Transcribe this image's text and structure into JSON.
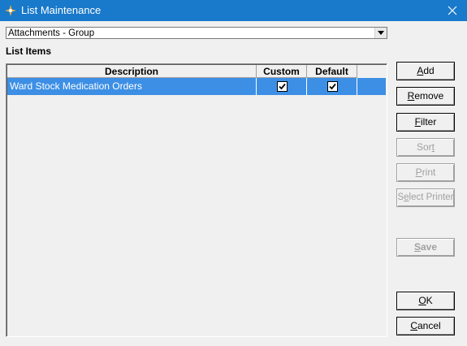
{
  "window": {
    "title": "List Maintenance",
    "close_glyph": "×"
  },
  "combo": {
    "value": "Attachments - Group"
  },
  "list_label": "List Items",
  "grid": {
    "columns": [
      "Description",
      "Custom",
      "Default"
    ],
    "rows": [
      {
        "description": "Ward Stock Medication Orders",
        "custom": true,
        "default": true
      }
    ]
  },
  "buttons": {
    "add": {
      "pre": "",
      "key": "A",
      "post": "dd",
      "enabled": true
    },
    "remove": {
      "pre": "",
      "key": "R",
      "post": "emove",
      "enabled": true
    },
    "filter": {
      "pre": "",
      "key": "F",
      "post": "ilter",
      "enabled": true
    },
    "sort": {
      "pre": "Sor",
      "key": "t",
      "post": "",
      "enabled": false
    },
    "print": {
      "pre": "",
      "key": "P",
      "post": "rint",
      "enabled": false
    },
    "select_printer": {
      "pre": "S",
      "key": "e",
      "post": "lect Printer",
      "enabled": false
    },
    "save": {
      "pre": "",
      "key": "S",
      "post": "ave",
      "enabled": false
    },
    "ok": {
      "pre": "",
      "key": "O",
      "post": "K",
      "enabled": true
    },
    "cancel": {
      "pre": "",
      "key": "C",
      "post": "ancel",
      "enabled": true
    }
  },
  "colors": {
    "titlebar": "#1979ca",
    "selection": "#3c8fe5"
  }
}
